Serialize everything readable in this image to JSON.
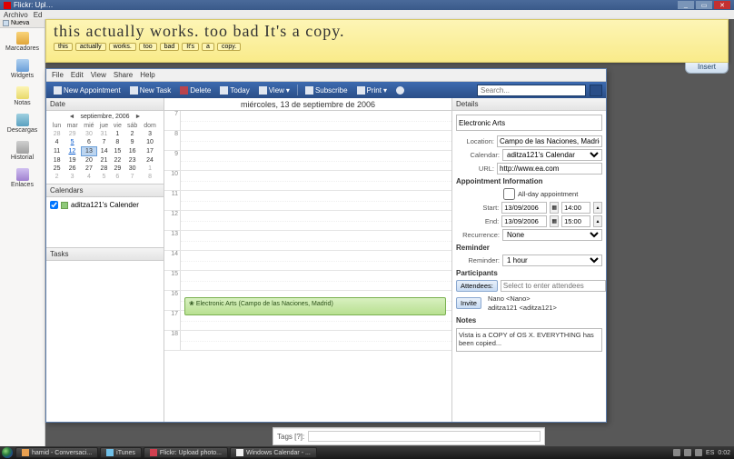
{
  "titlebar": {
    "title": "Flickr: Upl…"
  },
  "browser_menu": {
    "archivo": "Archivo",
    "edit": "Ed"
  },
  "opera": {
    "tiny": {
      "nueva": "Nueva"
    },
    "items": [
      {
        "label": "Marcadores"
      },
      {
        "label": "Widgets"
      },
      {
        "label": "Notas"
      },
      {
        "label": "Descargas"
      },
      {
        "label": "Historial"
      },
      {
        "label": "Enlaces"
      }
    ]
  },
  "sticky": {
    "text": "this actually works. too bad It's a copy.",
    "tags": [
      "this",
      "actually",
      "works.",
      "too",
      "bad",
      "It's",
      "a",
      "copy."
    ],
    "insert": "Insert"
  },
  "cal": {
    "menu": {
      "file": "File",
      "edit": "Edit",
      "view": "View",
      "share": "Share",
      "help": "Help"
    },
    "toolbar": {
      "new_appt": "New Appointment",
      "new_task": "New Task",
      "delete": "Delete",
      "today": "Today",
      "view": "View",
      "subscribe": "Subscribe",
      "print": "Print",
      "search_ph": "Search..."
    },
    "panels": {
      "date": "Date",
      "calendars": "Calendars",
      "tasks": "Tasks",
      "details": "Details"
    },
    "mini": {
      "month": "septiembre, 2006",
      "dow": [
        "lun",
        "mar",
        "mié",
        "jue",
        "vie",
        "sáb",
        "dom"
      ],
      "weeks": [
        [
          {
            "d": "28",
            "g": 1
          },
          {
            "d": "29",
            "g": 1
          },
          {
            "d": "30",
            "g": 1
          },
          {
            "d": "31",
            "g": 1
          },
          {
            "d": "1"
          },
          {
            "d": "2"
          },
          {
            "d": "3"
          }
        ],
        [
          {
            "d": "4"
          },
          {
            "d": "5",
            "l": 1
          },
          {
            "d": "6"
          },
          {
            "d": "7"
          },
          {
            "d": "8"
          },
          {
            "d": "9"
          },
          {
            "d": "10"
          }
        ],
        [
          {
            "d": "11"
          },
          {
            "d": "12",
            "l": 1
          },
          {
            "d": "13",
            "s": 1
          },
          {
            "d": "14"
          },
          {
            "d": "15"
          },
          {
            "d": "16"
          },
          {
            "d": "17"
          }
        ],
        [
          {
            "d": "18"
          },
          {
            "d": "19"
          },
          {
            "d": "20"
          },
          {
            "d": "21"
          },
          {
            "d": "22"
          },
          {
            "d": "23"
          },
          {
            "d": "24"
          }
        ],
        [
          {
            "d": "25"
          },
          {
            "d": "26"
          },
          {
            "d": "27"
          },
          {
            "d": "28"
          },
          {
            "d": "29"
          },
          {
            "d": "30"
          },
          {
            "d": "1",
            "g": 1
          }
        ],
        [
          {
            "d": "2",
            "g": 1
          },
          {
            "d": "3",
            "g": 1
          },
          {
            "d": "4",
            "g": 1
          },
          {
            "d": "5",
            "g": 1
          },
          {
            "d": "6",
            "g": 1
          },
          {
            "d": "7",
            "g": 1
          },
          {
            "d": "8",
            "g": 1
          }
        ]
      ]
    },
    "cal_item": "aditza121's Calender",
    "date_header": "miércoles, 13 de septiembre de 2006",
    "hours": [
      "7",
      "8",
      "9",
      "10",
      "11",
      "12",
      "13",
      "14",
      "15",
      "16",
      "17",
      "18"
    ],
    "event": {
      "text": "Electronic Arts (Campo de las Naciones, Madrid)"
    },
    "details": {
      "title": "Electronic Arts",
      "location_lbl": "Location:",
      "location": "Campo de las Naciones, Madrid",
      "calendar_lbl": "Calendar:",
      "calendar": "aditza121's Calendar",
      "url_lbl": "URL:",
      "url": "http://www.ea.com",
      "appt_info": "Appointment Information",
      "allday": "All-day appointment",
      "start_lbl": "Start:",
      "start_date": "13/09/2006",
      "start_time": "14:00",
      "end_lbl": "End:",
      "end_date": "13/09/2006",
      "end_time": "15:00",
      "recur_lbl": "Recurrence:",
      "recur": "None",
      "reminder_hd": "Reminder",
      "reminder_lbl": "Reminder:",
      "reminder": "1 hour",
      "participants": "Participants",
      "attendees_btn": "Attendees:",
      "attendees_ph": "Select to enter attendees",
      "invite_btn": "Invite",
      "part1": "Nano <Nano>",
      "part2": "aditza121 <aditza121>",
      "notes_hd": "Notes",
      "notes": "Vista is a COPY of OS X. EVERYTHING has been copied..."
    }
  },
  "under": {
    "tags_lbl": "Tags [?]:"
  },
  "taskbar": {
    "items": [
      {
        "label": "hamid - Conversaci..."
      },
      {
        "label": "iTunes"
      },
      {
        "label": "Flickr: Upload photo..."
      },
      {
        "label": "Windows Calendar - ..."
      }
    ],
    "time": "0:02"
  }
}
